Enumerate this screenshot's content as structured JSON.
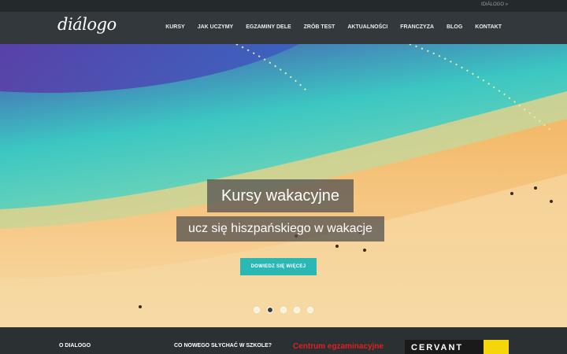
{
  "topbar": {
    "link": "IDIÁLOGO »"
  },
  "header": {
    "logo": "diálogo",
    "nav": [
      "KURSY",
      "JAK UCZYMY",
      "EGZAMINY DELE",
      "ZRÓB TEST",
      "AKTUALNOŚCI",
      "FRANCZYZA",
      "BLOG",
      "KONTAKT"
    ]
  },
  "hero": {
    "title": "Kursy wakacyjne",
    "subtitle": "ucz się hiszpańskiego w wakacje",
    "cta": "DOWIEDZ SIĘ WIĘCEJ",
    "slides_total": 5,
    "active_slide": 2
  },
  "footer": {
    "col1": "O DIALOGO",
    "col2": "CO NOWEGO SŁYCHAĆ W SZKOLE?",
    "exam_center": "Centrum egzaminacyjne",
    "partner_logo": "CERVANT"
  },
  "colors": {
    "accent": "#2bb8b4",
    "navbar": "#32383b",
    "topbar": "#24292b",
    "exam_red": "#e02020"
  }
}
